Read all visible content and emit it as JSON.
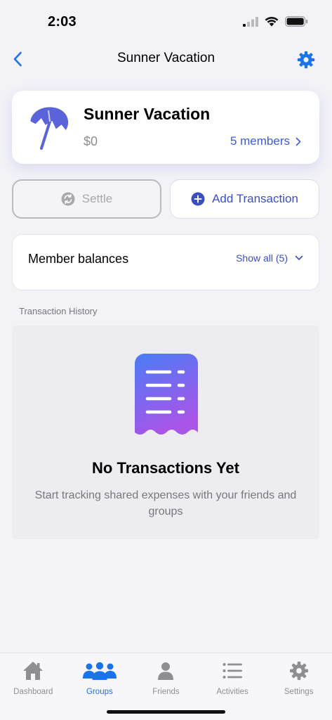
{
  "status_bar": {
    "time": "2:03"
  },
  "nav": {
    "title": "Sunner Vacation"
  },
  "group": {
    "name": "Sunner Vacation",
    "amount": "$0",
    "members_label": "5 members"
  },
  "actions": {
    "settle_label": "Settle",
    "add_label": "Add Transaction"
  },
  "balances": {
    "title": "Member balances",
    "show_all_label": "Show all (5)"
  },
  "history": {
    "section_label": "Transaction History",
    "empty_title": "No Transactions Yet",
    "empty_description": "Start tracking shared expenses with your friends and groups"
  },
  "tabs": [
    {
      "label": "Dashboard",
      "icon": "house-icon"
    },
    {
      "label": "Groups",
      "icon": "people-icon",
      "active": true
    },
    {
      "label": "Friends",
      "icon": "person-icon"
    },
    {
      "label": "Activities",
      "icon": "list-icon"
    },
    {
      "label": "Settings",
      "icon": "gear-icon"
    }
  ],
  "colors": {
    "accent": "#1a73e8",
    "brand_blue": "#3b4fc4",
    "background": "#f2f2f7",
    "receipt_gradient_top": "#4a7cf6",
    "receipt_gradient_bottom": "#a855e8"
  }
}
